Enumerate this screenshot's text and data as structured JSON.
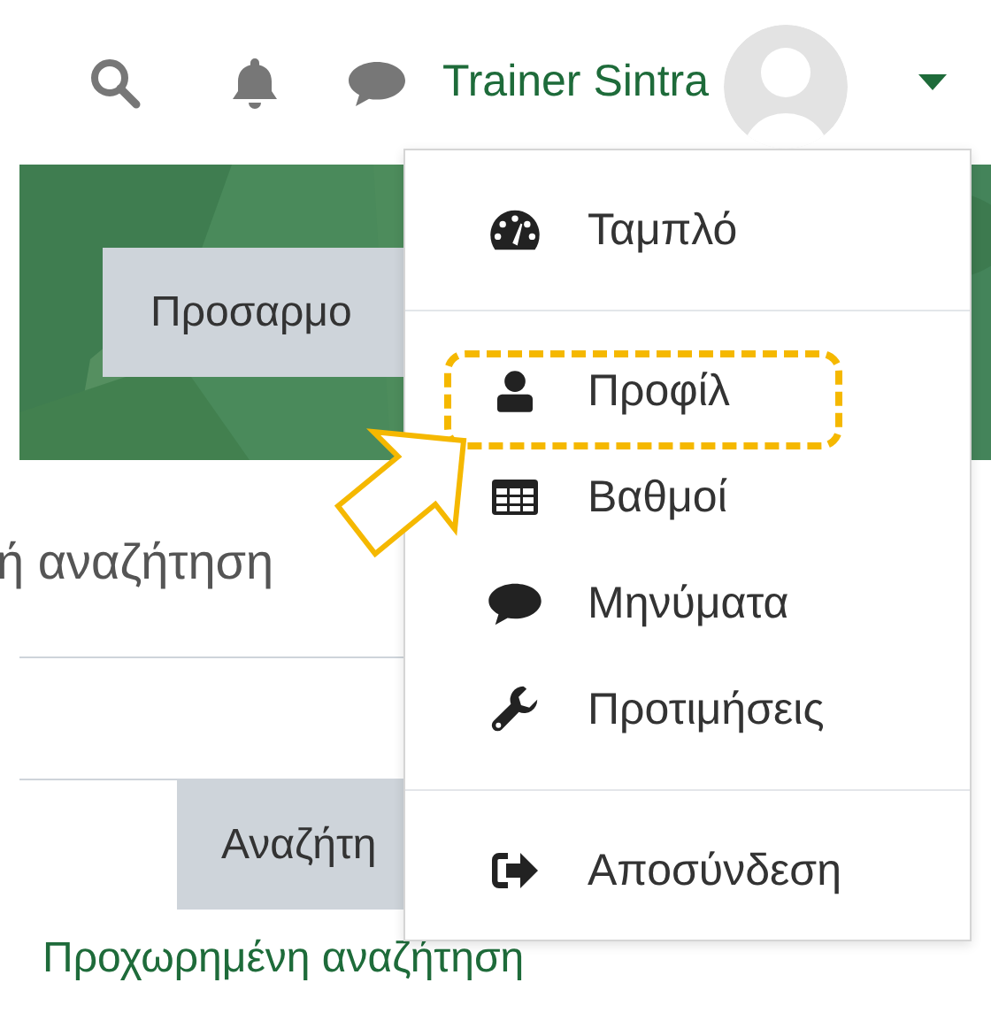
{
  "header": {
    "user_name": "Trainer Sintra"
  },
  "banner": {
    "button": "Προσαρμο"
  },
  "search": {
    "label": "ή αναζήτηση",
    "button": "Αναζήτη",
    "advanced_link": "Προχωρημένη αναζήτηση"
  },
  "user_menu": {
    "sections": [
      {
        "items": [
          {
            "label": "Ταμπλό"
          }
        ]
      },
      {
        "items": [
          {
            "label": "Προφίλ"
          },
          {
            "label": "Βαθμοί"
          },
          {
            "label": "Μηνύματα"
          },
          {
            "label": "Προτιμήσεις"
          }
        ]
      },
      {
        "items": [
          {
            "label": "Αποσύνδεση"
          }
        ]
      }
    ]
  },
  "callout": {
    "kind": "dashed-frame-with-arrow"
  }
}
